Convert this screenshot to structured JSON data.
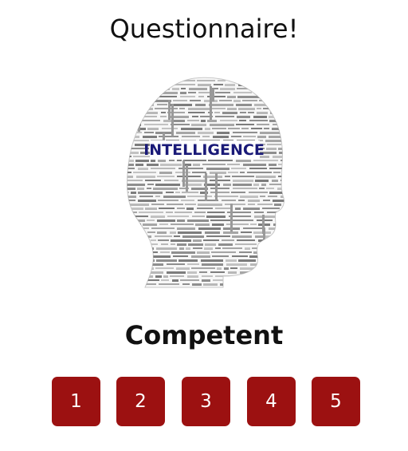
{
  "page": {
    "title": "Questionnaire!"
  },
  "illustration": {
    "highlight_word": "INTELLIGENCE",
    "highlight_color": "#1a1a78",
    "word_color": "#9a9a9a",
    "description_icon": "head-word-cloud-icon"
  },
  "question": {
    "label": "Competent"
  },
  "rating": {
    "button_color": "#9c1111",
    "options": [
      "1",
      "2",
      "3",
      "4",
      "5"
    ]
  }
}
